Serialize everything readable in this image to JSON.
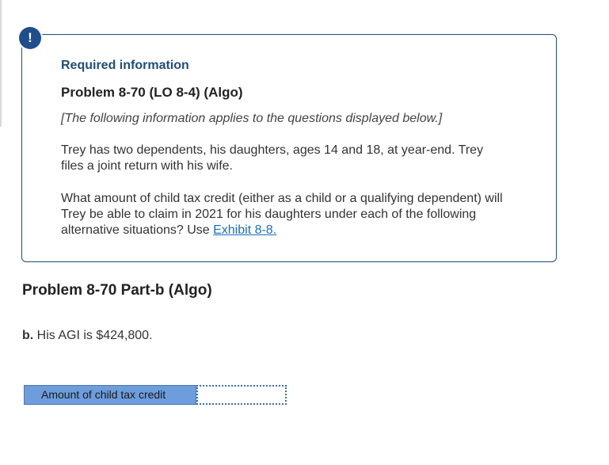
{
  "alert": {
    "icon": "exclamation-icon",
    "glyph": "!"
  },
  "info": {
    "heading": "Required information",
    "problem_title": "Problem 8-70 (LO 8-4) (Algo)",
    "note": "[The following information applies to the questions displayed below.]",
    "paragraph1": "Trey has two dependents, his daughters, ages 14 and 18, at year-end. Trey files a joint return with his wife.",
    "paragraph2": "What amount of child tax credit (either as a child or a qualifying dependent) will Trey be able to claim in 2021 for his daughters under each of the following alternative situations? Use ",
    "exhibit_link": "Exhibit 8-8."
  },
  "part": {
    "title": "Problem 8-70 Part-b (Algo)",
    "question_prefix": "b.",
    "question_text": " His AGI is $424,800."
  },
  "answer": {
    "label": "Amount of child tax credit",
    "value": ""
  },
  "colors": {
    "accent": "#1f4e79",
    "label_bg": "#6d9ddb",
    "link": "#1a6fb5"
  }
}
